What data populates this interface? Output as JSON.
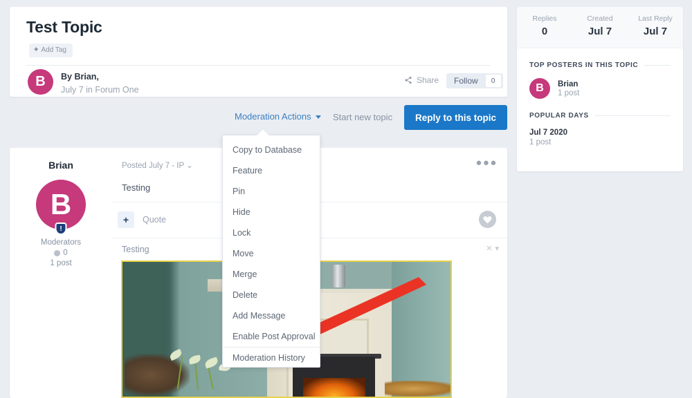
{
  "topic": {
    "title": "Test Topic",
    "add_tag_label": "Add Tag",
    "add_tag_icon": "plus-icon",
    "author_initial": "B",
    "byline_name": "By Brian,",
    "byline_sub": "July 7 in Forum One",
    "share_label": "Share",
    "share_icon": "share-icon",
    "follow_label": "Follow",
    "follow_count": "0"
  },
  "action_bar": {
    "moderation_actions_label": "Moderation Actions",
    "caret_icon": "chevron-down-icon",
    "start_new_topic_label": "Start new topic",
    "reply_label": "Reply to this topic"
  },
  "dropdown": {
    "items": [
      {
        "label": "Copy to Database",
        "separated": false
      },
      {
        "label": "Feature",
        "separated": false
      },
      {
        "label": "Pin",
        "separated": false
      },
      {
        "label": "Hide",
        "separated": false
      },
      {
        "label": "Lock",
        "separated": false
      },
      {
        "label": "Move",
        "separated": false
      },
      {
        "label": "Merge",
        "separated": false
      },
      {
        "label": "Delete",
        "separated": false
      },
      {
        "label": "Add Message",
        "separated": false
      },
      {
        "label": "Enable Post Approval",
        "separated": false
      },
      {
        "label": "Moderation History",
        "separated": true
      }
    ]
  },
  "post": {
    "author": "Brian",
    "author_initial": "B",
    "badge_glyph": "!",
    "group": "Moderators",
    "reputation": "0",
    "post_count": "1 post",
    "meta": "Posted July 7 - IP",
    "meta_caret": "chevron-down-icon",
    "dots_icon": "more-options-icon",
    "snippet": "Testing",
    "quote_plus": "+",
    "quote_label": "Quote",
    "heart_icon": "heart-icon",
    "body_text": "Testing",
    "image_tools_icon": "remove-image-icon",
    "image_tools_caret": "chevron-down-icon",
    "image_alt": "living room fireplace with wood burning stove, teal walls and calla lilies"
  },
  "sidebar": {
    "stats": [
      {
        "label": "Replies",
        "value": "0"
      },
      {
        "label": "Created",
        "value": "Jul 7"
      },
      {
        "label": "Last Reply",
        "value": "Jul 7"
      }
    ],
    "top_posters_heading": "TOP POSTERS IN THIS TOPIC",
    "top_posters": [
      {
        "initial": "B",
        "name": "Brian",
        "posts": "1 post"
      }
    ],
    "popular_days_heading": "POPULAR DAYS",
    "popular_days": [
      {
        "date": "Jul 7 2020",
        "posts": "1 post"
      }
    ]
  },
  "annotation": {
    "arrow_color": "#ea3324",
    "arrow_points_to": "Moderation History"
  },
  "colors": {
    "page_background": "#eaedf2",
    "card_background": "#ffffff",
    "primary_button": "#1b78c8",
    "link": "#3d7fc1",
    "avatar": "#c6397b",
    "image_border": "#e8d14c"
  }
}
